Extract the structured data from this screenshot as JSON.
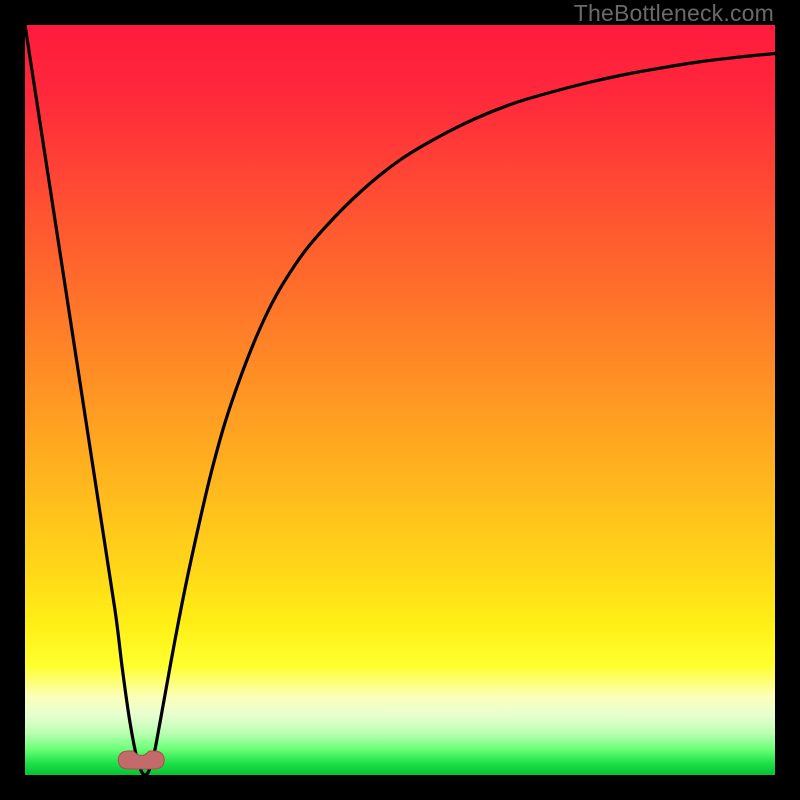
{
  "watermark": {
    "text": "TheBottleneck.com"
  },
  "colors": {
    "frame": "#000000",
    "curve": "#000000",
    "marker_fill": "#c46a6a",
    "marker_stroke": "#a94f4f"
  },
  "gradient_stops": [
    {
      "offset": 0.0,
      "color": "#ff1a3d"
    },
    {
      "offset": 0.1,
      "color": "#ff2a3b"
    },
    {
      "offset": 0.22,
      "color": "#ff4b33"
    },
    {
      "offset": 0.35,
      "color": "#ff6e2b"
    },
    {
      "offset": 0.48,
      "color": "#ff9224"
    },
    {
      "offset": 0.6,
      "color": "#ffb41e"
    },
    {
      "offset": 0.72,
      "color": "#ffd519"
    },
    {
      "offset": 0.8,
      "color": "#fff016"
    },
    {
      "offset": 0.855,
      "color": "#ffff30"
    },
    {
      "offset": 0.895,
      "color": "#fbffb8"
    },
    {
      "offset": 0.92,
      "color": "#e8ffd0"
    },
    {
      "offset": 0.945,
      "color": "#b8ffb0"
    },
    {
      "offset": 0.965,
      "color": "#6cff78"
    },
    {
      "offset": 0.985,
      "color": "#1de048"
    },
    {
      "offset": 1.0,
      "color": "#05c234"
    }
  ],
  "chart_data": {
    "type": "line",
    "title": "",
    "xlabel": "",
    "ylabel": "",
    "xlim": [
      0,
      100
    ],
    "ylim": [
      0,
      100
    ],
    "grid": false,
    "legend": false,
    "series": [
      {
        "name": "bottleneck-curve",
        "x": [
          0,
          2,
          4,
          6,
          8,
          10,
          12,
          13,
          14,
          15,
          16,
          17,
          18,
          20,
          22,
          25,
          28,
          32,
          36,
          40,
          45,
          50,
          55,
          60,
          65,
          70,
          75,
          80,
          85,
          90,
          95,
          100
        ],
        "y": [
          100,
          87,
          74,
          61,
          48,
          35,
          22,
          14,
          7,
          2,
          0,
          2,
          7,
          18,
          28,
          41,
          51,
          61,
          68,
          73,
          78,
          82,
          85,
          87.5,
          89.5,
          91,
          92.3,
          93.4,
          94.3,
          95.1,
          95.7,
          96.2
        ]
      }
    ],
    "marker": {
      "x": 15.5,
      "y": 0,
      "shape": "rounded-notch"
    },
    "annotations": []
  }
}
